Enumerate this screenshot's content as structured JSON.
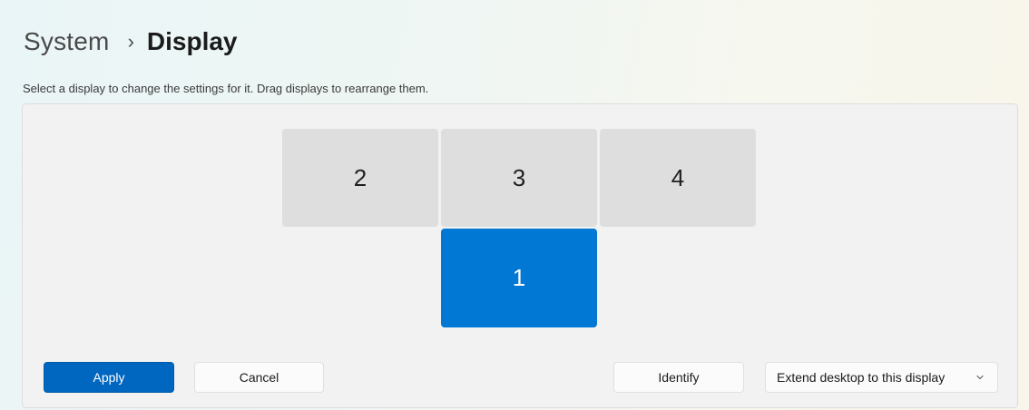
{
  "breadcrumb": {
    "parent": "System",
    "separator": "›",
    "current": "Display"
  },
  "instructions": "Select a display to change the settings for it. Drag displays to rearrange them.",
  "displays": [
    {
      "label": "2",
      "selected": false
    },
    {
      "label": "3",
      "selected": false
    },
    {
      "label": "4",
      "selected": false
    },
    {
      "label": "1",
      "selected": true
    }
  ],
  "buttons": {
    "apply": "Apply",
    "cancel": "Cancel",
    "identify": "Identify"
  },
  "multi_display_mode": {
    "selected": "Extend desktop to this display",
    "icon": "chevron-down-icon"
  },
  "colors": {
    "accent": "#0067c0",
    "selected_display": "#0078d4",
    "unselected_display": "#dedede"
  }
}
